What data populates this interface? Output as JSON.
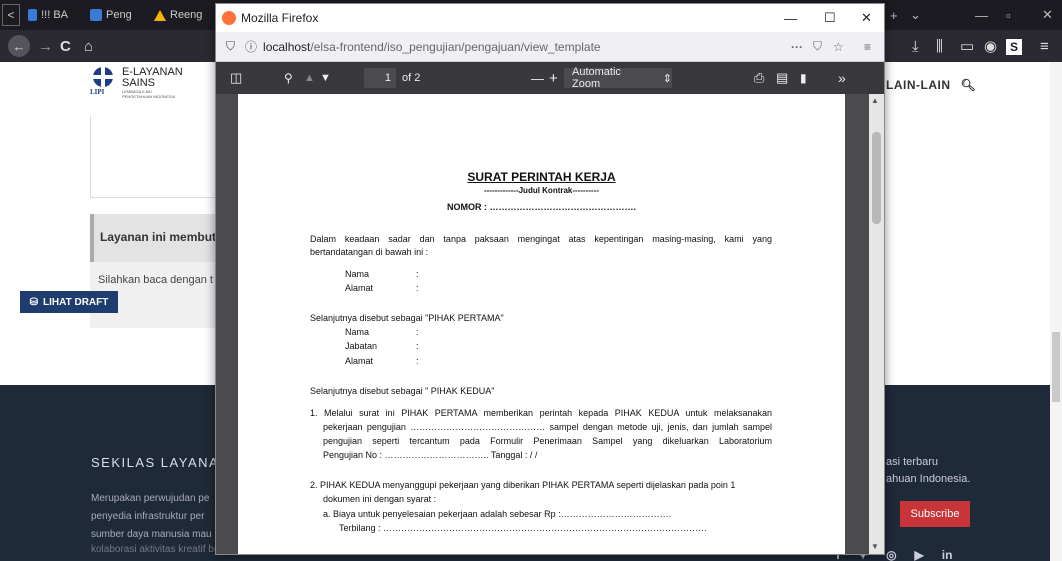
{
  "browser": {
    "tabs": [
      {
        "label": "!!! BA"
      },
      {
        "label": "Peng"
      },
      {
        "label": "Reeng"
      }
    ],
    "nav_back": "←",
    "nav_forward": "→",
    "nav_reload": "C",
    "nav_home": "⌂",
    "new_tab": "+",
    "tab_list": "⌄",
    "minimize": "—",
    "restore": "▫",
    "close": "✕"
  },
  "website": {
    "logo_title_1": "E-LAYANAN",
    "logo_title_2": "SAINS",
    "logo_sub_1": "LEMBAGA ILMU",
    "logo_sub_2": "PENGETAHUAN INDONESIA",
    "logo_abbrev": "LIPI",
    "menu_item": "LAIN-LAIN",
    "service_heading": "Layanan ini membutu",
    "service_text": "Silahkan baca dengan t",
    "draft_button": "LIHAT DRAFT",
    "footer_title": "SEKILAS LAYANAN",
    "footer_para": [
      "Merupakan perwujudan pe",
      "penyedia infrastruktur per",
      "sumber daya manusia mau"
    ],
    "footer_para_last": "kolaborasi aktivitas kreatif berbasis ilmu pengetahuan dan teknologi yang",
    "news_line_1": "asi terbaru",
    "news_line_2": "ahuan Indonesia.",
    "subscribe_button": "Subscribe",
    "social_icons": [
      "facebook-icon",
      "twitter-icon",
      "instagram-icon",
      "youtube-icon",
      "linkedin-icon"
    ]
  },
  "popup": {
    "title": "Mozilla Firefox",
    "url_host": "localhost",
    "url_path": "/elsa-frontend/iso_pengujian/pengajuan/view_template",
    "url_menu": "···",
    "pdf": {
      "page_current": "1",
      "page_total": "of 2",
      "zoom_out": "—",
      "zoom_in": "+",
      "zoom_value": "Automatic Zoom",
      "more_tools": "»"
    },
    "document": {
      "title": "SURAT PERINTAH KERJA",
      "subtitle": "-------------Judul Kontrak----------",
      "nomor": "NOMOR : ………………………………………….",
      "intro": "Dalam keadaan sadar dan tanpa paksaan mengingat atas kepentingan masing-masing, kami yang",
      "intro_2": "bertandatangan di bawah ini :",
      "party1_fields": [
        "Nama",
        "Alamat"
      ],
      "party1_label": "Selanjutnya disebut sebagai \"PIHAK PERTAMA\"",
      "party2_fields": [
        "Nama",
        "Jabatan",
        "Alamat"
      ],
      "party2_label": "Selanjutnya disebut sebagai \" PIHAK KEDUA\"",
      "colon": ":",
      "item1_line1": "1. Melalui surat ini  PIHAK PERTAMA memberikan perintah kepada PIHAK KEDUA untuk melaksanakan",
      "item1_line2": "pekerjaan pengujian ……………………………………… sampel dengan metode uji, jenis, dan jumlah sampel",
      "item1_line3": "pengujian seperti tercantum pada Formulir Penerimaan Sampel yang dikeluarkan Laboratorium",
      "item1_line4": "Pengujian No :  …………………………….. Tanggal :     /      /",
      "item2_line1": "2. PIHAK KEDUA menyanggupi pekerjaan yang diberikan PIHAK PERTAMA seperti dijelaskan pada poin 1",
      "item2_line2": "dokumen ini dengan syarat :",
      "item2_a": "a.   Biaya untuk penyelesaian pekerjaan adalah sebesar Rp :……………………………….",
      "item2_a_2": "Terbilang : ………………………………………………………………………………………………"
    }
  }
}
